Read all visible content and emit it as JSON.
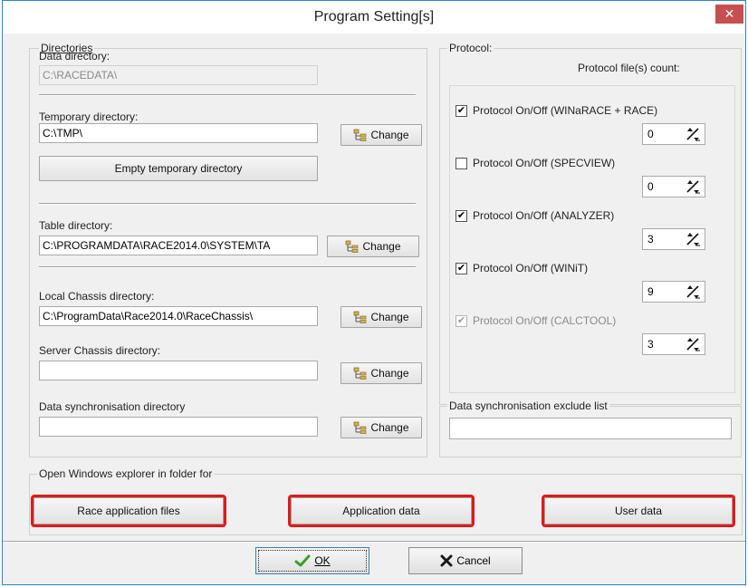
{
  "window": {
    "title": "Program Setting[s]",
    "close_glyph": "✕"
  },
  "directories": {
    "group_title": "Directories",
    "data": {
      "label": "Data directory:",
      "value": "C:\\RACEDATA\\"
    },
    "temporary": {
      "label": "Temporary directory:",
      "value": "C:\\TMP\\",
      "change_label": "Change",
      "empty_label": "Empty temporary directory"
    },
    "table": {
      "label": "Table directory:",
      "value": "C:\\PROGRAMDATA\\RACE2014.0\\SYSTEM\\TA",
      "change_label": "Change"
    },
    "local_chassis": {
      "label": "Local Chassis directory:",
      "value": "C:\\ProgramData\\Race2014.0\\RaceChassis\\",
      "change_label": "Change"
    },
    "server_chassis": {
      "label": "Server Chassis directory:",
      "value": "",
      "change_label": "Change"
    },
    "data_sync": {
      "label": "Data synchronisation directory",
      "value": "",
      "change_label": "Change"
    }
  },
  "protocol": {
    "group_title": "Protocol:",
    "count_label": "Protocol file(s) count:",
    "items": [
      {
        "label": "Protocol On/Off (WINaRACE + RACE)",
        "checked": true,
        "enabled": true,
        "count": "0"
      },
      {
        "label": "Protocol On/Off (SPECVIEW)",
        "checked": false,
        "enabled": true,
        "count": "0"
      },
      {
        "label": "Protocol On/Off (ANALYZER)",
        "checked": true,
        "enabled": true,
        "count": "3"
      },
      {
        "label": "Protocol On/Off (WINiT)",
        "checked": true,
        "enabled": true,
        "count": "9"
      },
      {
        "label": "Protocol On/Off (CALCTOOL)",
        "checked": true,
        "enabled": false,
        "count": "3"
      }
    ]
  },
  "exclude": {
    "group_title": "Data synchronisation exclude list",
    "value": ""
  },
  "explorer": {
    "group_title": "Open Windows explorer in folder for",
    "race_files_label": "Race application files",
    "app_data_label": "Application data",
    "user_data_label": "User data"
  },
  "footer": {
    "ok_label": "OK",
    "cancel_label": "Cancel"
  },
  "colors": {
    "highlight": "#e11a1a",
    "close_bg": "#c74f4f",
    "ok_check": "#3aa022",
    "cancel_x": "#1a1a1a"
  },
  "icons": {
    "change": "folder-tree-icon",
    "spin": "spin-arrows-icon",
    "ok": "check-icon",
    "cancel": "x-icon",
    "close": "close-icon"
  }
}
